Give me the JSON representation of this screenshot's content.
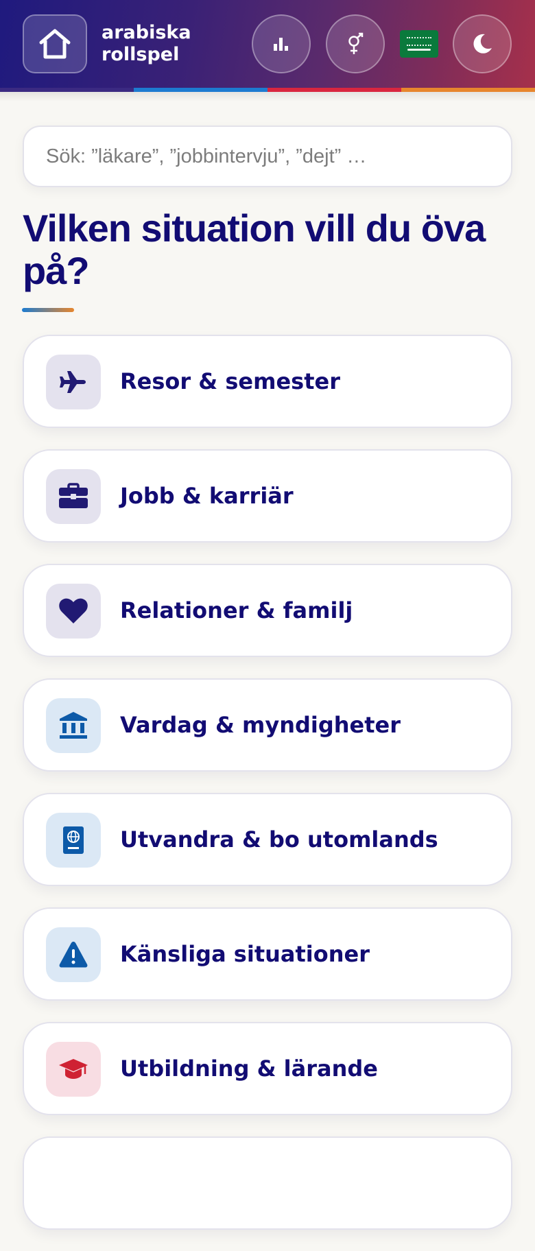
{
  "header": {
    "app_name_line1": "arabiska",
    "app_name_line2": "rollspel"
  },
  "search": {
    "placeholder": "Sök: ”läkare”, ”jobbintervju”, ”dejt” …",
    "value": ""
  },
  "main": {
    "title": "Vilken situation vill du öva på?"
  },
  "categories": [
    {
      "label": "Resor & semester",
      "icon": "airplane-icon"
    },
    {
      "label": "Jobb & karriär",
      "icon": "briefcase-icon"
    },
    {
      "label": "Relationer & familj",
      "icon": "heart-icon"
    },
    {
      "label": "Vardag & myndigheter",
      "icon": "government-building-icon"
    },
    {
      "label": "Utvandra & bo utomlands",
      "icon": "passport-icon"
    },
    {
      "label": "Känsliga situationer",
      "icon": "warning-icon"
    },
    {
      "label": "Utbildning & lärande",
      "icon": "graduation-cap-icon"
    }
  ],
  "colors": {
    "title": "#120c73",
    "accent_blue": "#1d7bd0",
    "accent_red": "#d9263f",
    "accent_orange": "#e7862d"
  }
}
